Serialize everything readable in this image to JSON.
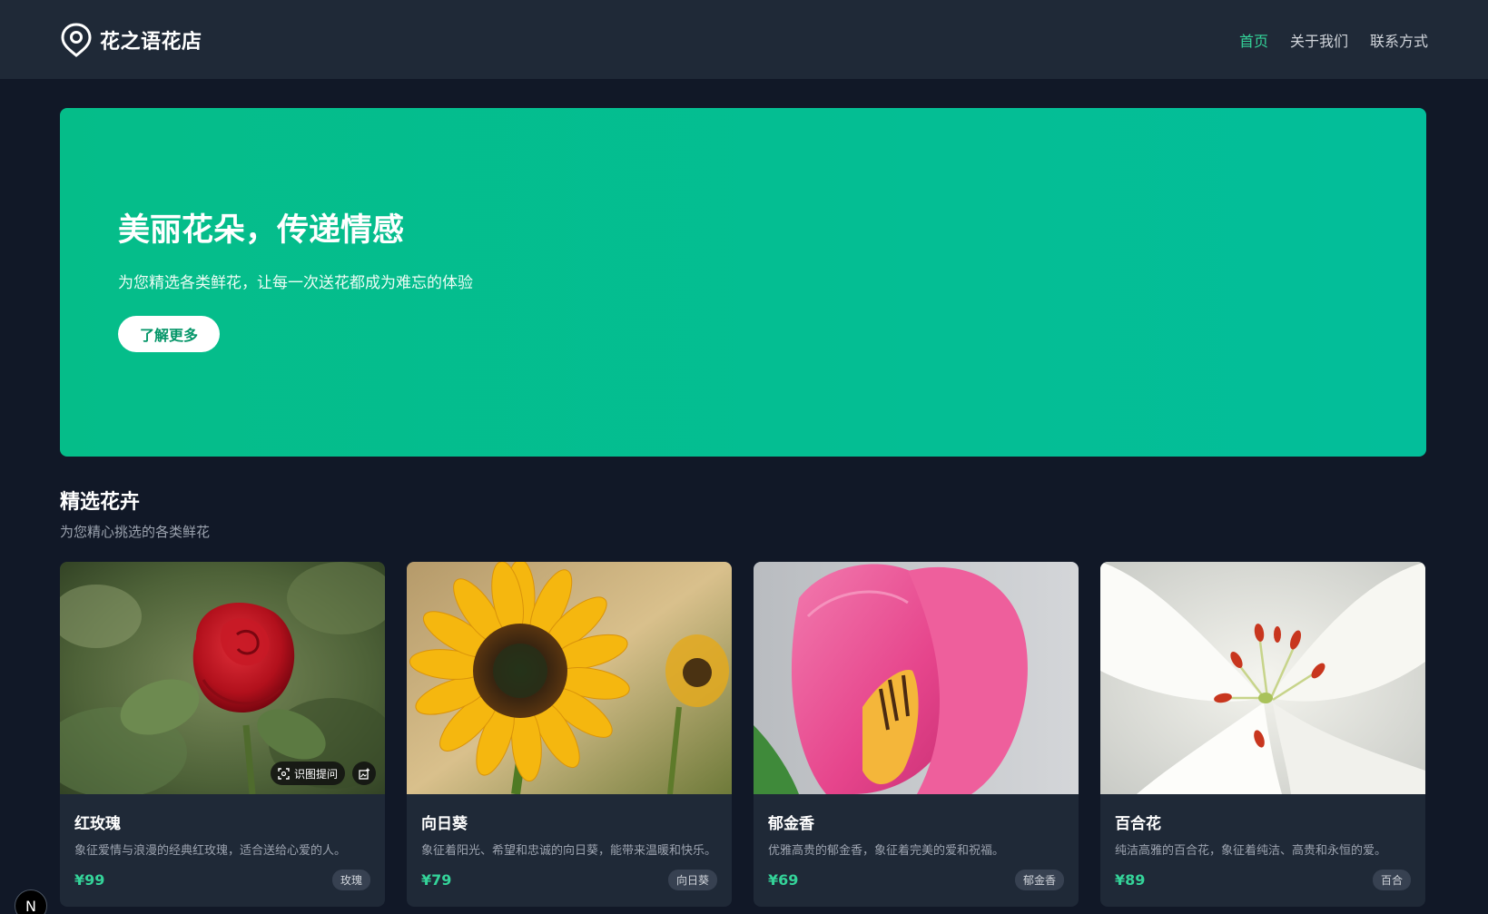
{
  "brand": {
    "name": "花之语花店",
    "icon": "location-pin-icon"
  },
  "nav": [
    {
      "label": "首页",
      "active": true
    },
    {
      "label": "关于我们",
      "active": false
    },
    {
      "label": "联系方式",
      "active": false
    }
  ],
  "hero": {
    "title": "美丽花朵，传递情感",
    "subtitle": "为您精选各类鲜花，让每一次送花都成为难忘的体验",
    "button_label": "了解更多"
  },
  "section": {
    "title": "精选花卉",
    "subtitle": "为您精心挑选的各类鲜花"
  },
  "image_tools": {
    "ask_label": "识图提问",
    "ask_icon": "scan-icon",
    "edit_icon": "image-edit-icon"
  },
  "products": [
    {
      "name": "红玫瑰",
      "description": "象征爱情与浪漫的经典红玫瑰，适合送给心爱的人。",
      "price": "¥99",
      "tag": "玫瑰"
    },
    {
      "name": "向日葵",
      "description": "象征着阳光、希望和忠诚的向日葵，能带来温暖和快乐。",
      "price": "¥79",
      "tag": "向日葵"
    },
    {
      "name": "郁金香",
      "description": "优雅高贵的郁金香，象征着完美的爱和祝福。",
      "price": "¥69",
      "tag": "郁金香"
    },
    {
      "name": "百合花",
      "description": "纯洁高雅的百合花，象征着纯洁、高贵和永恒的爱。",
      "price": "¥89",
      "tag": "百合"
    }
  ],
  "dev_badge": {
    "label": "N"
  },
  "colors": {
    "accent": "#34d399",
    "hero_start": "#05bd89",
    "hero_end": "#03be9a",
    "background": "#111827",
    "surface": "#1f2937"
  }
}
